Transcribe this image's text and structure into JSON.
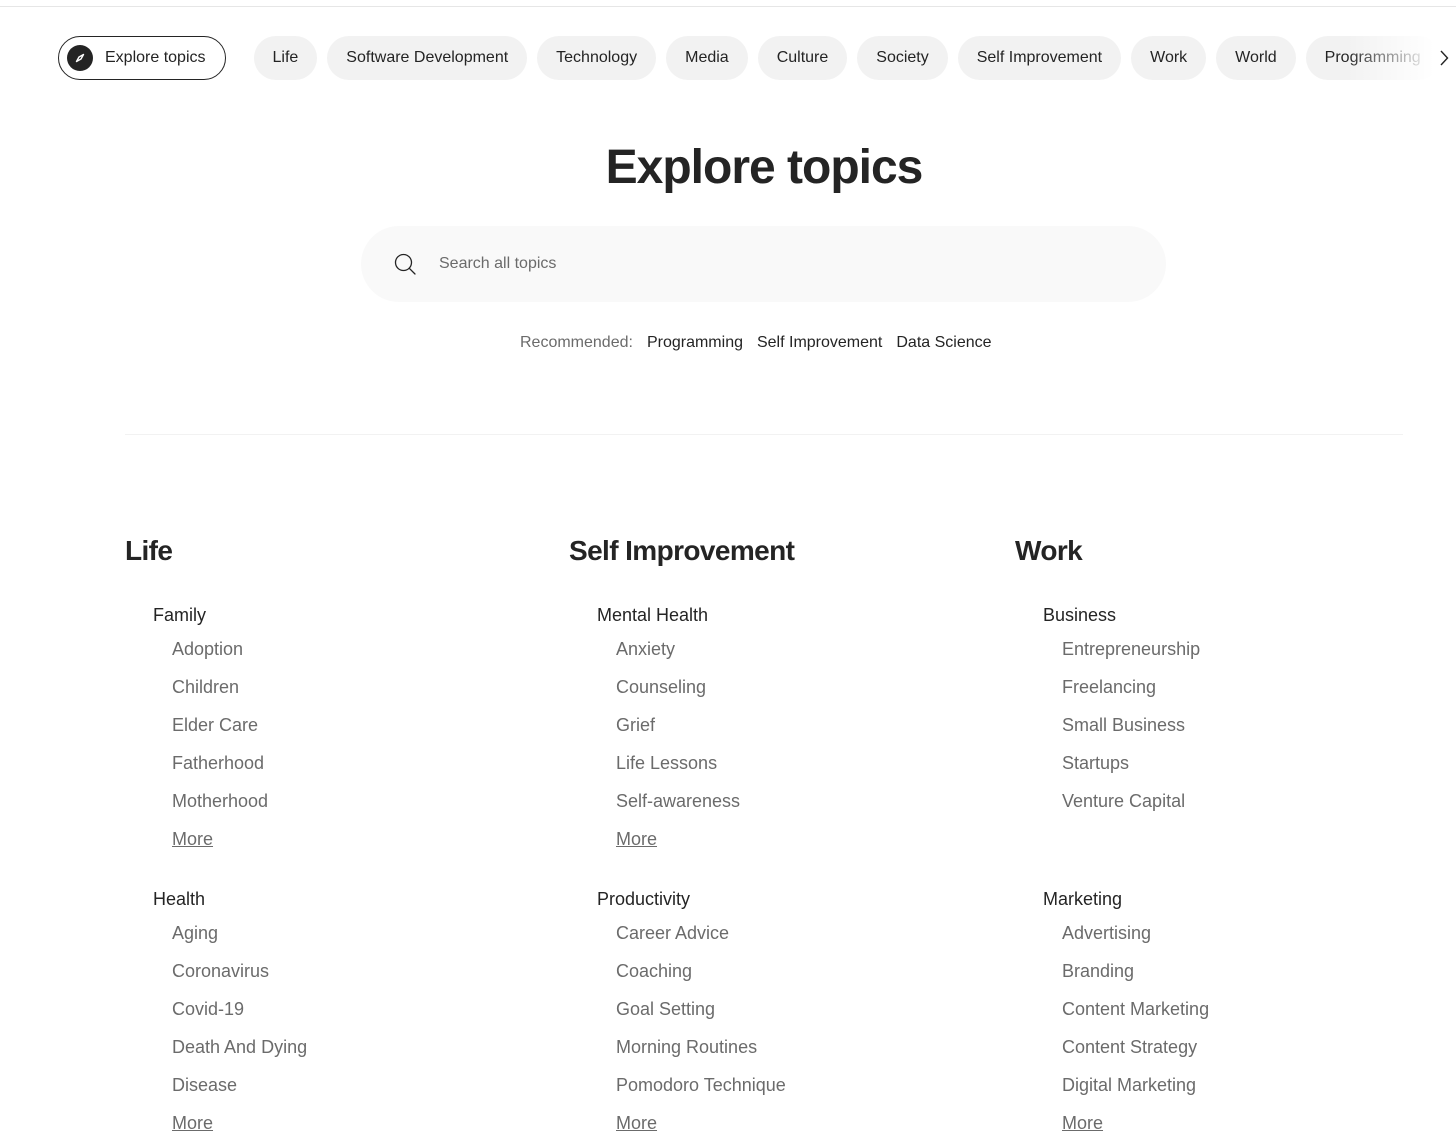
{
  "chips": {
    "explore_label": "Explore topics",
    "items": [
      "Life",
      "Software Development",
      "Technology",
      "Media",
      "Culture",
      "Society",
      "Self Improvement",
      "Work",
      "World",
      "Programming"
    ]
  },
  "hero": {
    "title": "Explore topics"
  },
  "search": {
    "placeholder": "Search all topics"
  },
  "recommended": {
    "label": "Recommended:",
    "links": [
      "Programming",
      "Self Improvement",
      "Data Science"
    ]
  },
  "columns": [
    {
      "title": "Life",
      "groups": [
        {
          "title": "Family",
          "topics": [
            "Adoption",
            "Children",
            "Elder Care",
            "Fatherhood",
            "Motherhood"
          ],
          "more": "More"
        },
        {
          "title": "Health",
          "topics": [
            "Aging",
            "Coronavirus",
            "Covid-19",
            "Death And Dying",
            "Disease"
          ],
          "more": "More"
        }
      ]
    },
    {
      "title": "Self Improvement",
      "groups": [
        {
          "title": "Mental Health",
          "topics": [
            "Anxiety",
            "Counseling",
            "Grief",
            "Life Lessons",
            "Self-awareness"
          ],
          "more": "More"
        },
        {
          "title": "Productivity",
          "topics": [
            "Career Advice",
            "Coaching",
            "Goal Setting",
            "Morning Routines",
            "Pomodoro Technique"
          ],
          "more": "More"
        }
      ]
    },
    {
      "title": "Work",
      "groups": [
        {
          "title": "Business",
          "topics": [
            "Entrepreneurship",
            "Freelancing",
            "Small Business",
            "Startups",
            "Venture Capital"
          ],
          "more": ""
        },
        {
          "title": "Marketing",
          "topics": [
            "Advertising",
            "Branding",
            "Content Marketing",
            "Content Strategy",
            "Digital Marketing"
          ],
          "more": "More"
        }
      ]
    }
  ]
}
